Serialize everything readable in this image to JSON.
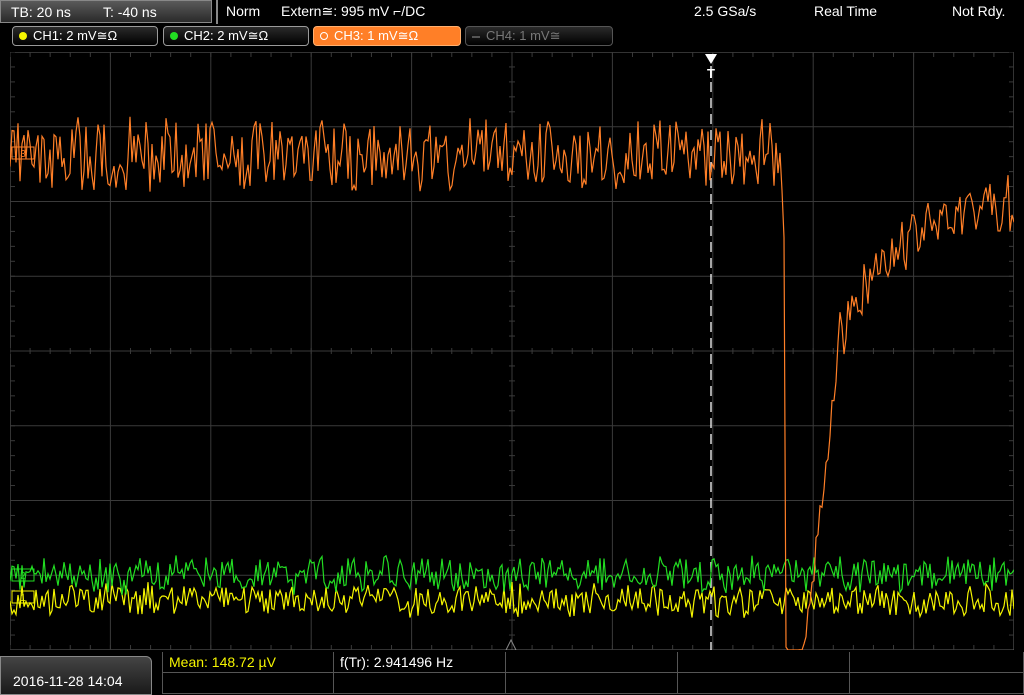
{
  "status": {
    "tb": "TB: 20 ns",
    "t": "T: -40 ns",
    "mode": "Norm",
    "trigger": "Extern≅: 995 mV ⌐/DC",
    "rate": "2.5 GSa/s",
    "acq": "Real Time",
    "ready": "Not Rdy."
  },
  "channels": [
    {
      "label": "CH1: 2 mV≅Ω",
      "color": "#f5f500"
    },
    {
      "label": "CH2: 2 mV≅Ω",
      "color": "#22dd22"
    },
    {
      "label": "CH3: 1 mV≅Ω",
      "color": "#ff7f27"
    },
    {
      "label": "CH4: 1 mV≅",
      "color": "#666666"
    }
  ],
  "markers": {
    "trigger": "T",
    "ch3": "3",
    "ch2": "2",
    "ch1": "1"
  },
  "bottom": {
    "date": "2016-11-28 14:04",
    "mean_label": "Mean: 148.72 µV",
    "freq_label": "f(Tr): 2.941496 Hz"
  },
  "colors": {
    "ch1": "#f5f500",
    "ch2": "#22dd22",
    "ch3": "#ff7f27",
    "grid": "#3a3a3a"
  }
}
